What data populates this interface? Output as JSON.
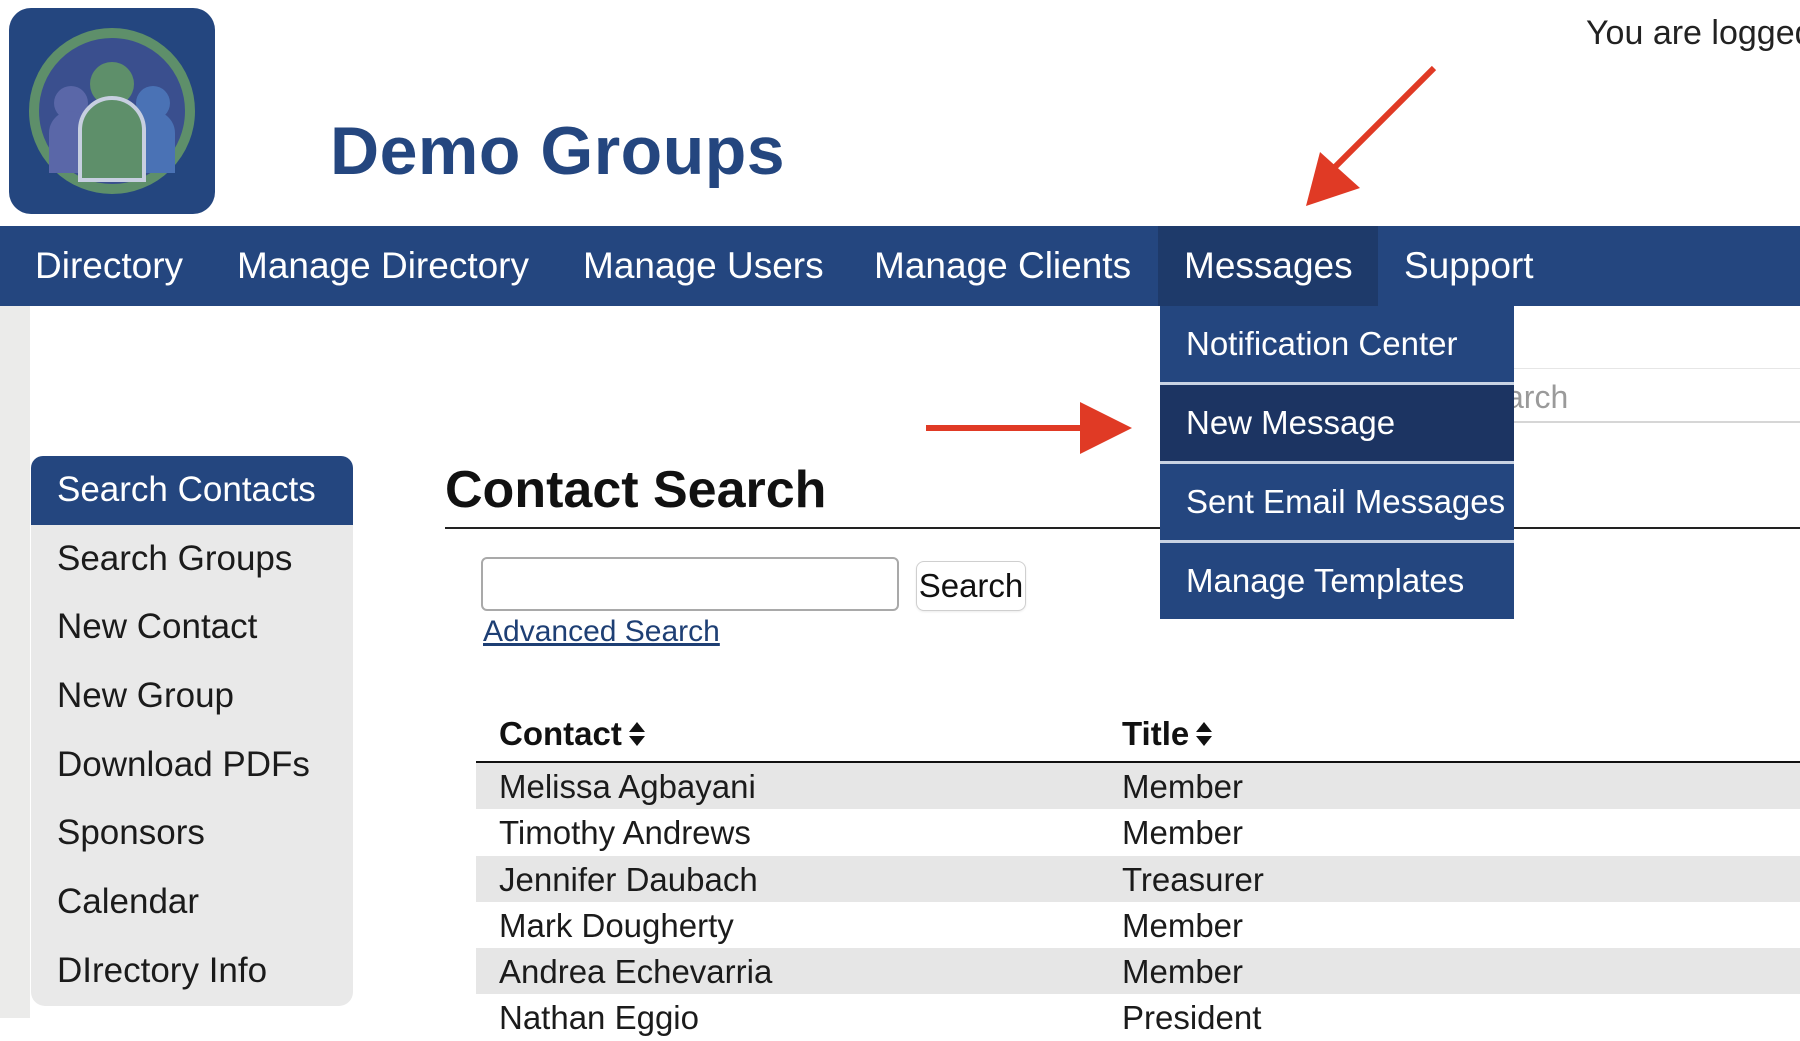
{
  "header": {
    "site_title": "Demo Groups",
    "login_text": "You are logged"
  },
  "navbar": {
    "items": [
      {
        "label": "Directory"
      },
      {
        "label": "Manage Directory"
      },
      {
        "label": "Manage Users"
      },
      {
        "label": "Manage Clients"
      },
      {
        "label": "Messages"
      },
      {
        "label": "Support"
      }
    ]
  },
  "messages_dropdown": {
    "items": [
      {
        "label": "Notification Center"
      },
      {
        "label": "New Message"
      },
      {
        "label": "Sent Email Messages"
      },
      {
        "label": "Manage Templates"
      }
    ]
  },
  "top_search": {
    "placeholder_visible": "arch"
  },
  "sidebar": {
    "items": [
      {
        "label": "Search Contacts"
      },
      {
        "label": "Search Groups"
      },
      {
        "label": "New Contact"
      },
      {
        "label": "New Group"
      },
      {
        "label": "Download PDFs"
      },
      {
        "label": "Sponsors"
      },
      {
        "label": "Calendar"
      },
      {
        "label": "DIrectory Info"
      }
    ]
  },
  "main": {
    "title": "Contact Search",
    "search_value": "",
    "search_button": "Search",
    "advanced_link": "Advanced Search",
    "table": {
      "headers": [
        "Contact",
        "Title"
      ],
      "rows": [
        [
          "Melissa Agbayani",
          "Member"
        ],
        [
          "Timothy Andrews",
          "Member"
        ],
        [
          "Jennifer Daubach",
          "Treasurer"
        ],
        [
          "Mark Dougherty",
          "Member"
        ],
        [
          "Andrea Echevarria",
          "Member"
        ],
        [
          "Nathan Eggio",
          "President"
        ]
      ]
    }
  },
  "colors": {
    "brand_navy": "#24467f",
    "annotation_arrow": "#e03a25",
    "row_stripe": "#e6e6e6"
  }
}
